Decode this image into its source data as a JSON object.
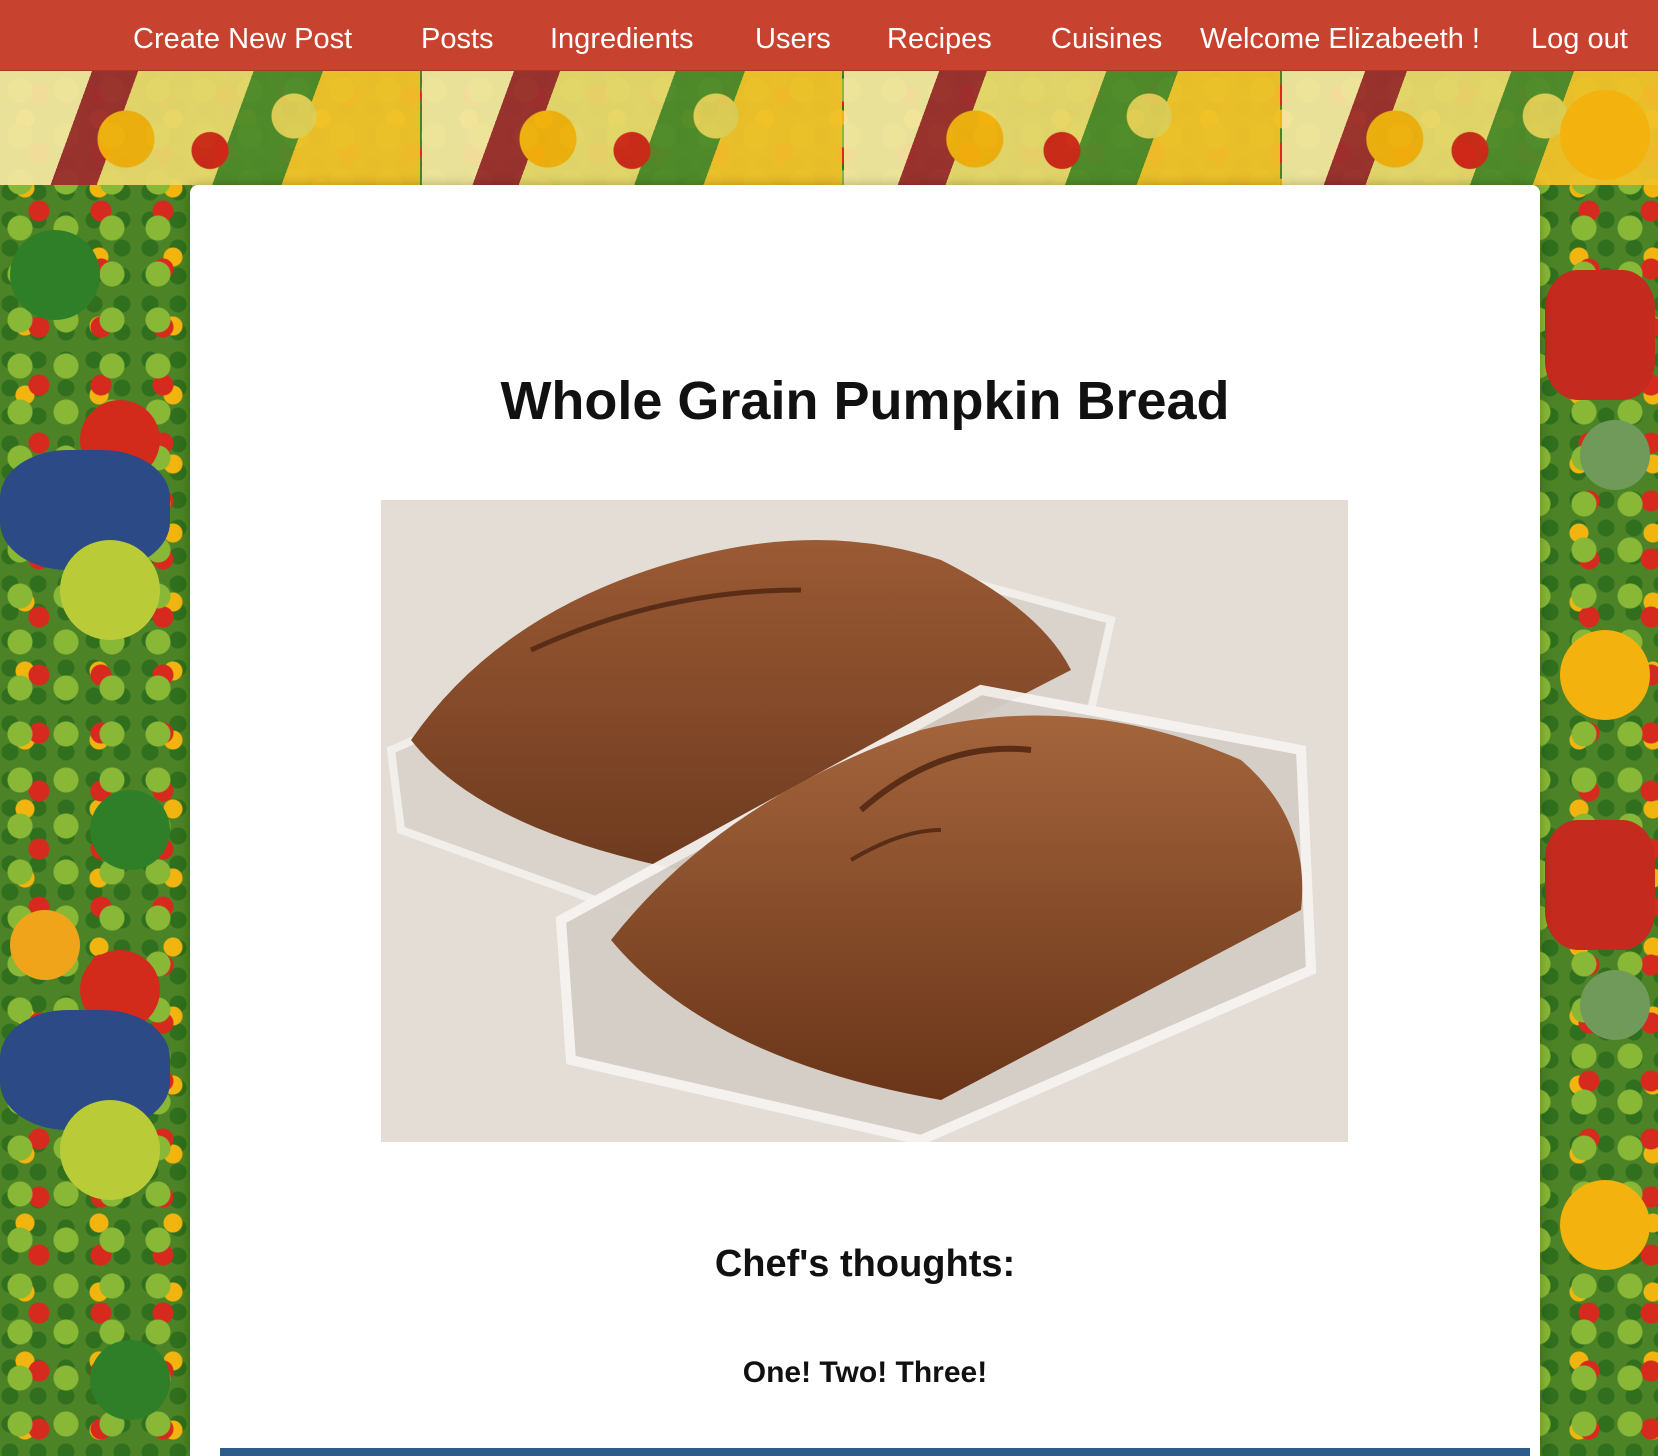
{
  "nav": {
    "create_post": "Create New Post",
    "posts": "Posts",
    "ingredients": "Ingredients",
    "users": "Users",
    "recipes": "Recipes",
    "cuisines": "Cuisines",
    "welcome": "Welcome Elizabeeth !",
    "logout": "Log out"
  },
  "post": {
    "title": "Whole Grain Pumpkin Bread",
    "image_subject": "two loaves of pumpkin bread in glass loaf pans",
    "thoughts_heading": "Chef's thoughts:",
    "thoughts_body": "One! Two! Three!"
  },
  "colors": {
    "navbar": "#c8432f",
    "nav_text": "#ffffff",
    "card": "#ffffff",
    "text": "#111111"
  }
}
